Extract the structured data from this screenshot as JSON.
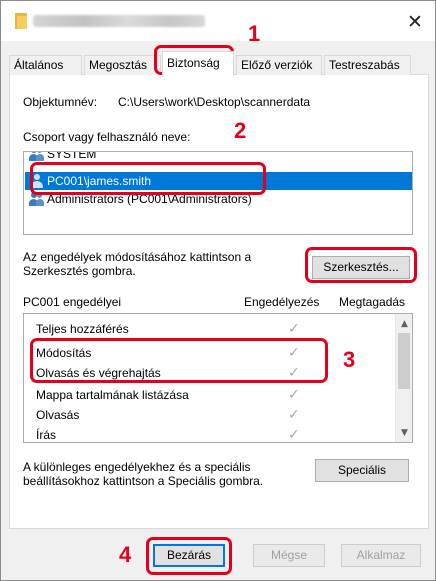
{
  "window": {
    "close_glyph": "✕"
  },
  "tabs": [
    {
      "label": "Általános"
    },
    {
      "label": "Megosztás"
    },
    {
      "label": "Biztonság"
    },
    {
      "label": "Előző verziók"
    },
    {
      "label": "Testreszabás"
    }
  ],
  "object": {
    "label": "Objektumnév:",
    "value": "C:\\Users\\work\\Desktop\\scannerdata"
  },
  "groups": {
    "label": "Csoport vagy felhasználó neve:",
    "items": [
      {
        "name": "SYSTEM"
      },
      {
        "name": "PC001\\james.smith",
        "selected": true
      },
      {
        "name": "Administrators (PC001\\Administrators)"
      }
    ]
  },
  "edit_hint": "Az engedélyek módosításához kattintson a Szerkesztés gombra.",
  "edit_button": "Szerkesztés...",
  "permissions": {
    "header_name": "PC001 engedélyei",
    "header_allow": "Engedélyezés",
    "header_deny": "Megtagadás",
    "rows": [
      {
        "name": "Teljes hozzáférés",
        "allow": false
      },
      {
        "name": "Módosítás",
        "allow": true
      },
      {
        "name": "Olvasás és végrehajtás",
        "allow": true
      },
      {
        "name": "Mappa tartalmának listázása",
        "allow": true
      },
      {
        "name": "Olvasás",
        "allow": true
      },
      {
        "name": "Írás",
        "allow": true
      }
    ]
  },
  "special_hint": "A különleges engedélyekhez és a speciális beállításokhoz kattintson a Speciális gombra.",
  "special_button": "Speciális",
  "footer": {
    "close": "Bezárás",
    "cancel": "Mégse",
    "apply": "Alkalmaz"
  },
  "steps": [
    "1",
    "2",
    "3",
    "4"
  ],
  "colors": {
    "callout": "#e3001b",
    "selection": "#0078d7"
  }
}
